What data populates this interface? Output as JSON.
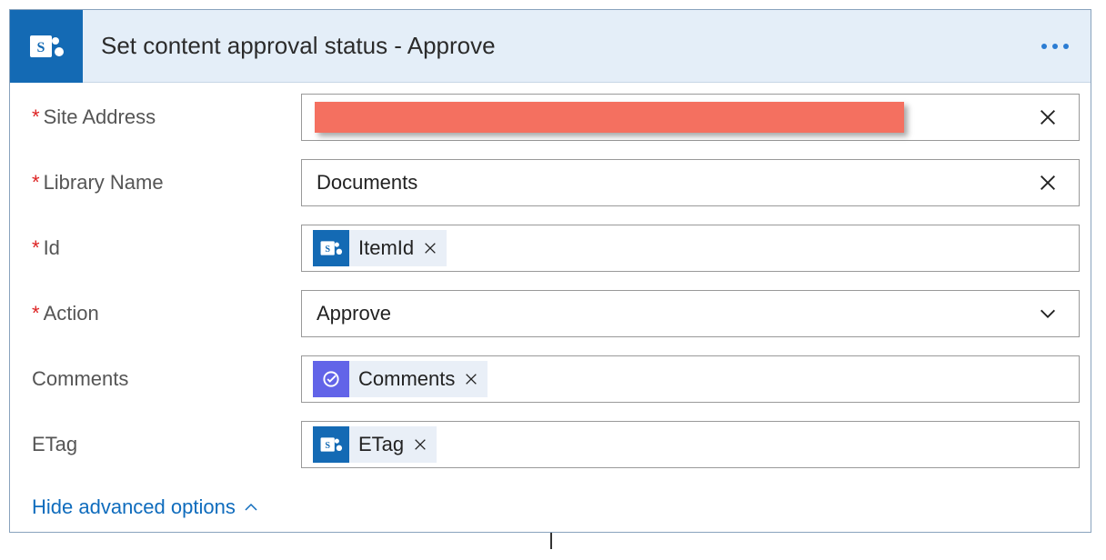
{
  "header": {
    "title": "Set content approval status - Approve"
  },
  "fields": {
    "siteAddress": {
      "label": "Site Address",
      "required": true
    },
    "libraryName": {
      "label": "Library Name",
      "required": true,
      "value": "Documents"
    },
    "id": {
      "label": "Id",
      "required": true,
      "token": "ItemId"
    },
    "action": {
      "label": "Action",
      "required": true,
      "value": "Approve"
    },
    "comments": {
      "label": "Comments",
      "required": false,
      "token": "Comments"
    },
    "etag": {
      "label": "ETag",
      "required": false,
      "token": "ETag"
    }
  },
  "footer": {
    "advanced": "Hide advanced options"
  },
  "icons": {
    "sharepoint": "sharepoint-icon",
    "approvals": "approvals-icon"
  }
}
